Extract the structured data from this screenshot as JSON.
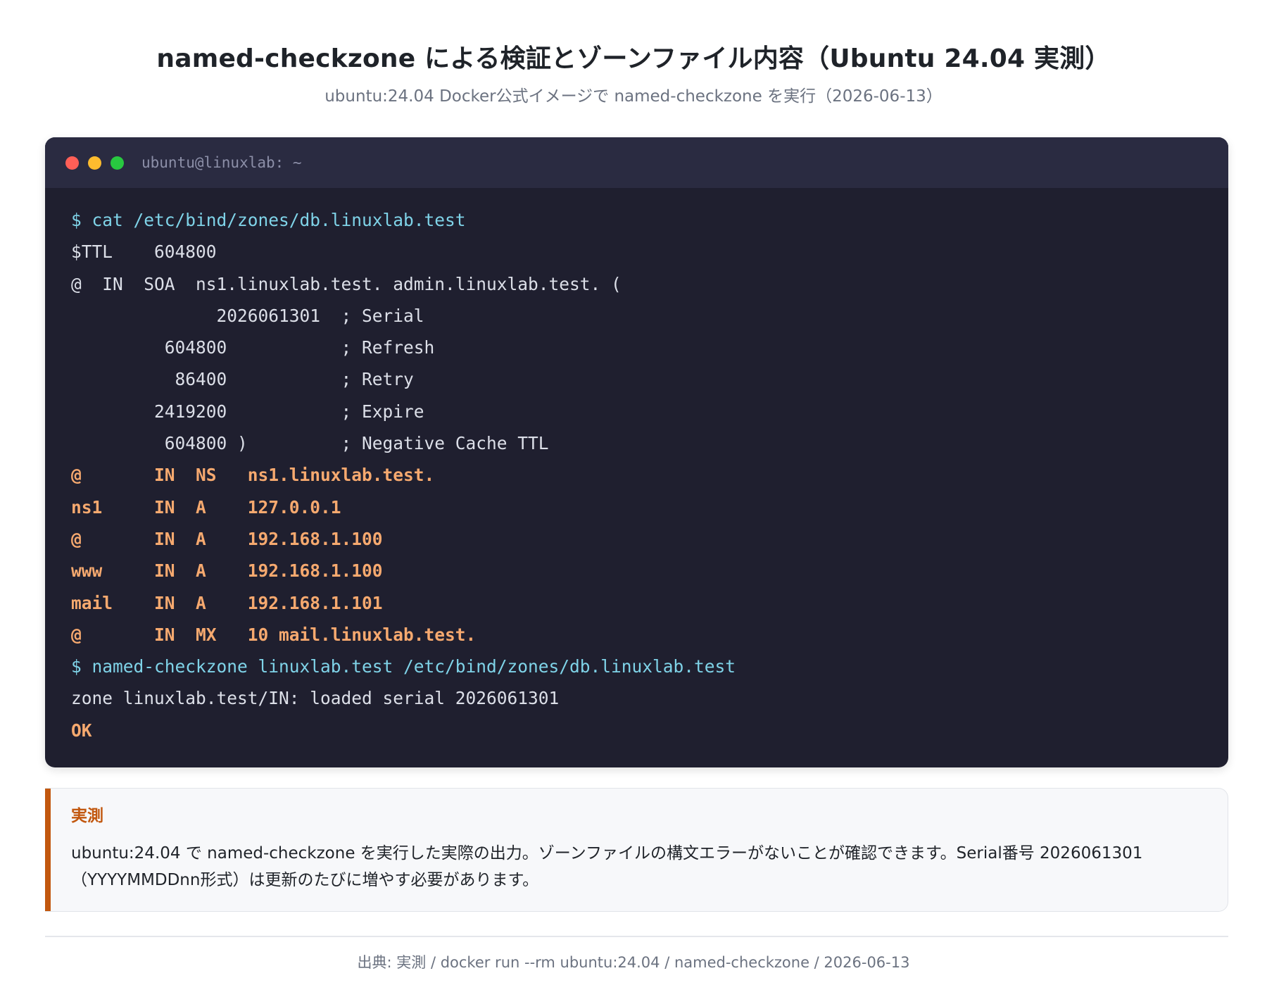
{
  "header": {
    "title": "named-checkzone による検証とゾーンファイル内容（Ubuntu 24.04 実測）",
    "subtitle": "ubuntu:24.04 Docker公式イメージで named-checkzone を実行（2026-06-13）"
  },
  "terminal": {
    "window_title": "ubuntu@linuxlab: ~",
    "lines": [
      {
        "kind": "cmd",
        "text": "$ cat /etc/bind/zones/db.linuxlab.test"
      },
      {
        "kind": "out",
        "text": "$TTL    604800"
      },
      {
        "kind": "out",
        "text": "@  IN  SOA  ns1.linuxlab.test. admin.linuxlab.test. ("
      },
      {
        "kind": "out",
        "text": "              2026061301  ; Serial"
      },
      {
        "kind": "out",
        "text": "         604800           ; Refresh"
      },
      {
        "kind": "out",
        "text": "          86400           ; Retry"
      },
      {
        "kind": "out",
        "text": "        2419200           ; Expire"
      },
      {
        "kind": "out",
        "text": "         604800 )         ; Negative Cache TTL"
      },
      {
        "kind": "hl",
        "text": "@       IN  NS   ns1.linuxlab.test."
      },
      {
        "kind": "hl",
        "text": "ns1     IN  A    127.0.0.1"
      },
      {
        "kind": "hl",
        "text": "@       IN  A    192.168.1.100"
      },
      {
        "kind": "hl",
        "text": "www     IN  A    192.168.1.100"
      },
      {
        "kind": "hl",
        "text": "mail    IN  A    192.168.1.101"
      },
      {
        "kind": "hl",
        "text": "@       IN  MX   10 mail.linuxlab.test."
      },
      {
        "kind": "cmd",
        "text": "$ named-checkzone linuxlab.test /etc/bind/zones/db.linuxlab.test"
      },
      {
        "kind": "out",
        "text": "zone linuxlab.test/IN: loaded serial 2026061301"
      },
      {
        "kind": "hl",
        "text": "OK"
      }
    ]
  },
  "callout": {
    "title": "実測",
    "text": "ubuntu:24.04 で named-checkzone を実行した実際の出力。ゾーンファイルの構文エラーがないことが確認できます。Serial番号 2026061301（YYYYMMDDnn形式）は更新のたびに増やす必要があります。"
  },
  "footer": {
    "source": "出典: 実測 / docker run --rm ubuntu:24.04 / named-checkzone / 2026-06-13"
  },
  "colors": {
    "terminal_bg": "#1f1f2f",
    "terminal_header_bg": "#2a2b41",
    "command": "#7fd3e8",
    "output": "#dcdfe8",
    "record_highlight": "#f6a96f",
    "accent": "#c2580f"
  },
  "icons": [
    "close-dot-icon",
    "minimize-dot-icon",
    "maximize-dot-icon"
  ]
}
